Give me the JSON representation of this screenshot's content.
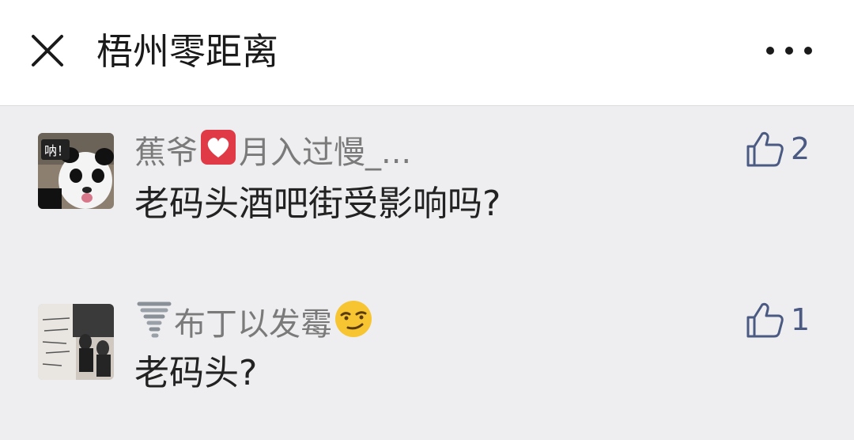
{
  "header": {
    "title": "梧州零距离",
    "close_icon": "close-icon",
    "more_icon": "more-dots-icon"
  },
  "comments": [
    {
      "avatar_text": "呐！",
      "name_prefix": "蕉爷",
      "name_emoji": "heart-icon",
      "name_suffix": "月入过慢_...",
      "text": "老码头酒吧街受影响吗?",
      "likes": "2"
    },
    {
      "name_emoji_prefix": "tornado-icon",
      "name": "布丁以发霉",
      "name_emoji_suffix": "smirk-face-icon",
      "text": "老码头?",
      "likes": "1"
    }
  ],
  "colors": {
    "background": "#eeeef0",
    "header_bg": "#ffffff",
    "name_gray": "#7a7a7a",
    "like_blue": "#4a5a82",
    "heart_red": "#e03a46"
  }
}
